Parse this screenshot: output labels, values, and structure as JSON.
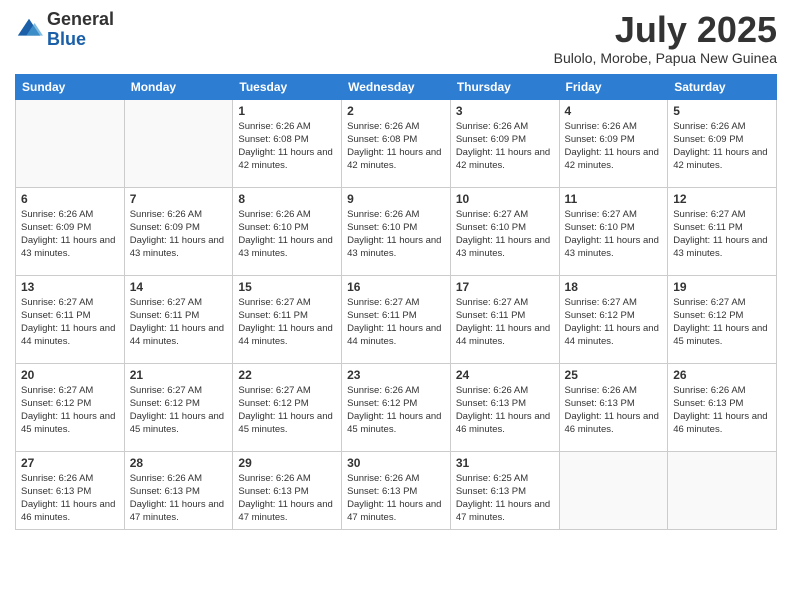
{
  "logo": {
    "general": "General",
    "blue": "Blue"
  },
  "header": {
    "month": "July 2025",
    "location": "Bulolo, Morobe, Papua New Guinea"
  },
  "weekdays": [
    "Sunday",
    "Monday",
    "Tuesday",
    "Wednesday",
    "Thursday",
    "Friday",
    "Saturday"
  ],
  "weeks": [
    [
      {
        "day": "",
        "info": ""
      },
      {
        "day": "",
        "info": ""
      },
      {
        "day": "1",
        "info": "Sunrise: 6:26 AM\nSunset: 6:08 PM\nDaylight: 11 hours and 42 minutes."
      },
      {
        "day": "2",
        "info": "Sunrise: 6:26 AM\nSunset: 6:08 PM\nDaylight: 11 hours and 42 minutes."
      },
      {
        "day": "3",
        "info": "Sunrise: 6:26 AM\nSunset: 6:09 PM\nDaylight: 11 hours and 42 minutes."
      },
      {
        "day": "4",
        "info": "Sunrise: 6:26 AM\nSunset: 6:09 PM\nDaylight: 11 hours and 42 minutes."
      },
      {
        "day": "5",
        "info": "Sunrise: 6:26 AM\nSunset: 6:09 PM\nDaylight: 11 hours and 42 minutes."
      }
    ],
    [
      {
        "day": "6",
        "info": "Sunrise: 6:26 AM\nSunset: 6:09 PM\nDaylight: 11 hours and 43 minutes."
      },
      {
        "day": "7",
        "info": "Sunrise: 6:26 AM\nSunset: 6:09 PM\nDaylight: 11 hours and 43 minutes."
      },
      {
        "day": "8",
        "info": "Sunrise: 6:26 AM\nSunset: 6:10 PM\nDaylight: 11 hours and 43 minutes."
      },
      {
        "day": "9",
        "info": "Sunrise: 6:26 AM\nSunset: 6:10 PM\nDaylight: 11 hours and 43 minutes."
      },
      {
        "day": "10",
        "info": "Sunrise: 6:27 AM\nSunset: 6:10 PM\nDaylight: 11 hours and 43 minutes."
      },
      {
        "day": "11",
        "info": "Sunrise: 6:27 AM\nSunset: 6:10 PM\nDaylight: 11 hours and 43 minutes."
      },
      {
        "day": "12",
        "info": "Sunrise: 6:27 AM\nSunset: 6:11 PM\nDaylight: 11 hours and 43 minutes."
      }
    ],
    [
      {
        "day": "13",
        "info": "Sunrise: 6:27 AM\nSunset: 6:11 PM\nDaylight: 11 hours and 44 minutes."
      },
      {
        "day": "14",
        "info": "Sunrise: 6:27 AM\nSunset: 6:11 PM\nDaylight: 11 hours and 44 minutes."
      },
      {
        "day": "15",
        "info": "Sunrise: 6:27 AM\nSunset: 6:11 PM\nDaylight: 11 hours and 44 minutes."
      },
      {
        "day": "16",
        "info": "Sunrise: 6:27 AM\nSunset: 6:11 PM\nDaylight: 11 hours and 44 minutes."
      },
      {
        "day": "17",
        "info": "Sunrise: 6:27 AM\nSunset: 6:11 PM\nDaylight: 11 hours and 44 minutes."
      },
      {
        "day": "18",
        "info": "Sunrise: 6:27 AM\nSunset: 6:12 PM\nDaylight: 11 hours and 44 minutes."
      },
      {
        "day": "19",
        "info": "Sunrise: 6:27 AM\nSunset: 6:12 PM\nDaylight: 11 hours and 45 minutes."
      }
    ],
    [
      {
        "day": "20",
        "info": "Sunrise: 6:27 AM\nSunset: 6:12 PM\nDaylight: 11 hours and 45 minutes."
      },
      {
        "day": "21",
        "info": "Sunrise: 6:27 AM\nSunset: 6:12 PM\nDaylight: 11 hours and 45 minutes."
      },
      {
        "day": "22",
        "info": "Sunrise: 6:27 AM\nSunset: 6:12 PM\nDaylight: 11 hours and 45 minutes."
      },
      {
        "day": "23",
        "info": "Sunrise: 6:26 AM\nSunset: 6:12 PM\nDaylight: 11 hours and 45 minutes."
      },
      {
        "day": "24",
        "info": "Sunrise: 6:26 AM\nSunset: 6:13 PM\nDaylight: 11 hours and 46 minutes."
      },
      {
        "day": "25",
        "info": "Sunrise: 6:26 AM\nSunset: 6:13 PM\nDaylight: 11 hours and 46 minutes."
      },
      {
        "day": "26",
        "info": "Sunrise: 6:26 AM\nSunset: 6:13 PM\nDaylight: 11 hours and 46 minutes."
      }
    ],
    [
      {
        "day": "27",
        "info": "Sunrise: 6:26 AM\nSunset: 6:13 PM\nDaylight: 11 hours and 46 minutes."
      },
      {
        "day": "28",
        "info": "Sunrise: 6:26 AM\nSunset: 6:13 PM\nDaylight: 11 hours and 47 minutes."
      },
      {
        "day": "29",
        "info": "Sunrise: 6:26 AM\nSunset: 6:13 PM\nDaylight: 11 hours and 47 minutes."
      },
      {
        "day": "30",
        "info": "Sunrise: 6:26 AM\nSunset: 6:13 PM\nDaylight: 11 hours and 47 minutes."
      },
      {
        "day": "31",
        "info": "Sunrise: 6:25 AM\nSunset: 6:13 PM\nDaylight: 11 hours and 47 minutes."
      },
      {
        "day": "",
        "info": ""
      },
      {
        "day": "",
        "info": ""
      }
    ]
  ]
}
